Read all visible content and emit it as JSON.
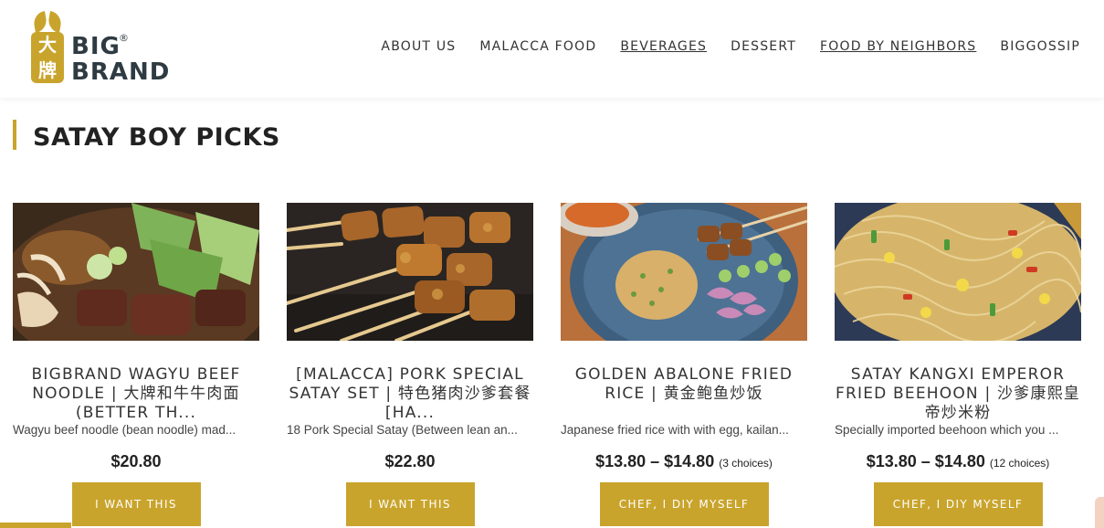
{
  "brand": {
    "logo_chars": [
      "大",
      "牌"
    ],
    "logo_word_1": "BIG",
    "logo_word_2": "BRAND",
    "registered": "®",
    "accent_color": "#c9a42c"
  },
  "nav": {
    "items": [
      {
        "label": "ABOUT US",
        "underlined": false
      },
      {
        "label": "MALACCA FOOD",
        "underlined": false
      },
      {
        "label": "BEVERAGES",
        "underlined": true
      },
      {
        "label": "DESSERT",
        "underlined": false
      },
      {
        "label": "FOOD BY NEIGHBORS",
        "underlined": true
      },
      {
        "label": "BIGGOSSIP",
        "underlined": false
      }
    ]
  },
  "section": {
    "title": "SATAY BOY PICKS"
  },
  "products": [
    {
      "name": "BIGBRAND WAGYU BEEF NOODLE | 大牌和牛牛肉面 (BETTER TH...",
      "description": "Wagyu beef noodle (bean noodle) mad...",
      "price": "$20.80",
      "choices": "",
      "button": "I WANT THIS",
      "image": "beef-noodle-photo"
    },
    {
      "name": "[MALACCA] PORK SPECIAL SATAY SET | 特色猪肉沙爹套餐 [HA...",
      "description": "18 Pork Special Satay (Between lean an...",
      "price": "$22.80",
      "choices": "",
      "button": "I WANT THIS",
      "image": "pork-satay-photo"
    },
    {
      "name": "GOLDEN ABALONE FRIED RICE | 黄金鲍鱼炒饭",
      "description": "Japanese fried rice with with egg, kailan...",
      "price": "$13.80 – $14.80",
      "choices": "(3 choices)",
      "button": "CHEF, I DIY MYSELF",
      "image": "fried-rice-photo"
    },
    {
      "name": "SATAY KANGXI EMPEROR FRIED BEEHOON | 沙爹康熙皇帝炒米粉",
      "description": "Specially imported beehoon which you ...",
      "price": "$13.80 – $14.80",
      "choices": "(12 choices)",
      "button": "CHEF, I DIY MYSELF",
      "image": "fried-beehoon-photo"
    }
  ]
}
